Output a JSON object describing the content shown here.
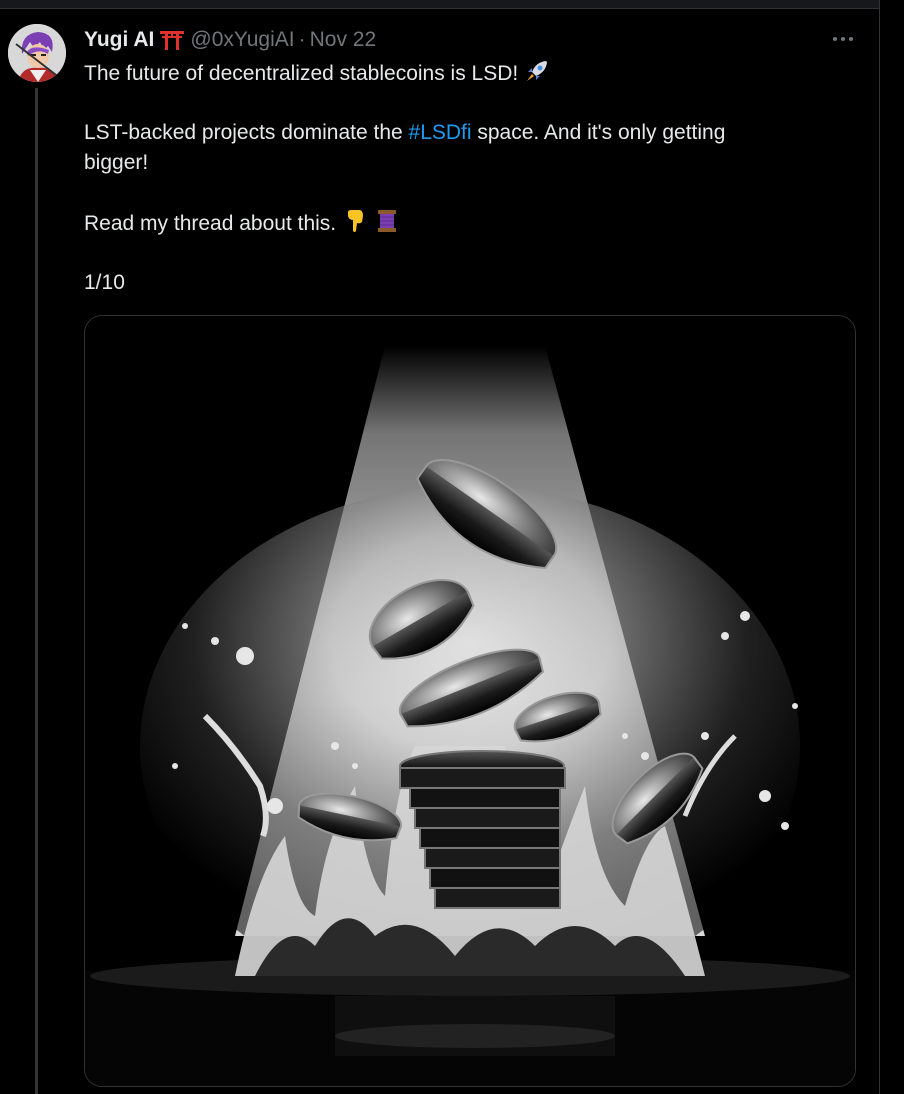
{
  "tweet": {
    "author": {
      "display_name": "Yugi AI",
      "name_emoji": "torii-gate",
      "handle": "@0xYugiAI",
      "separator": "·",
      "date": "Nov 22"
    },
    "text": {
      "line1": "The future of decentralized stablecoins is LSD!",
      "line1_emoji": "rocket",
      "line2_before": "LST-backed projects dominate the ",
      "line2_hashtag": "#LSDfi",
      "line2_after": " space. And it's only getting",
      "line3": "bigger!",
      "line4": "Read my thread about this.",
      "line4_emojis": [
        "pointing-down",
        "thread-spool"
      ],
      "line5": "1/10"
    },
    "media": {
      "description_icon": "coins-splashing-image"
    }
  },
  "colors": {
    "background": "#000000",
    "text": "#e7e9ea",
    "secondary": "#71767b",
    "link": "#1d9bf0",
    "border": "#2f3336"
  }
}
